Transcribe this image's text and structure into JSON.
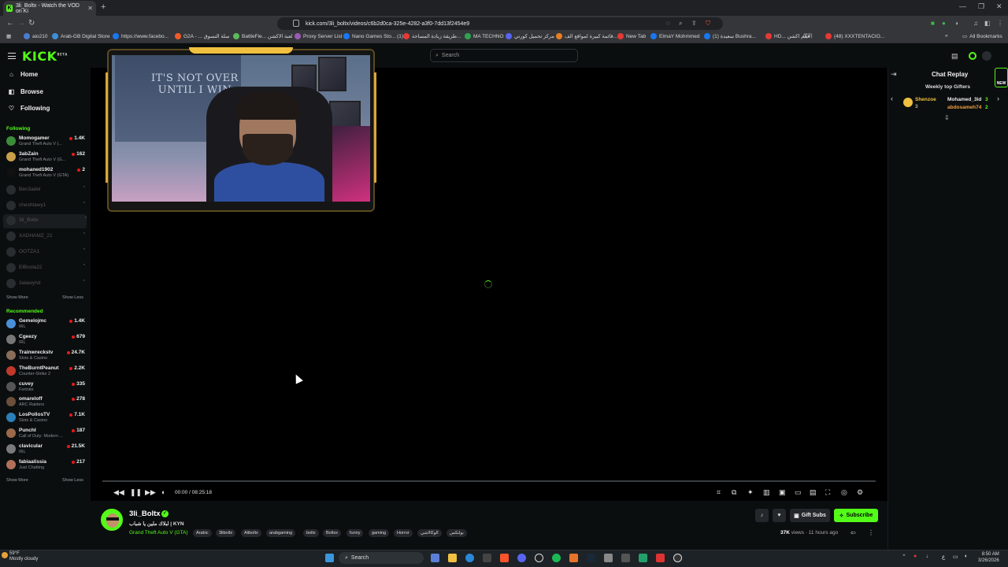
{
  "browser": {
    "tab_title": "3li_Boltx - Watch the VOD on Ki",
    "url": "kick.com/3li_boltx/videos/c6b2d0ca-325e-4282-a3f0-7dd13f2454e9",
    "bookmarks": [
      "aio210",
      "Arab-GB Digital Store",
      "https://www.facebo...",
      "G2A - ... سلة التسوق",
      "BattleFie... لعبة الاكشن",
      "Proxy Server List",
      "Nano Games Sto... (1)",
      "طريقة زيادة المساحة...",
      "MA TECHNO",
      "مركز تحميل كورتي",
      "قائمة كبيرة لمواقع الف...",
      "New Tab",
      "ElmaY Mohmmed",
      "(1) سعيدة Bushra...",
      "HD... فيلم اكشن",
      "(22)",
      "(48) XXXTENTACIO...",
      "All Bookmarks"
    ]
  },
  "kick": {
    "logo": "KICK",
    "logo_badge": "BETA",
    "search_placeholder": "Search"
  },
  "sidebar": {
    "nav": [
      {
        "label": "Home",
        "icon": "home-icon"
      },
      {
        "label": "Browse",
        "icon": "browse-icon"
      },
      {
        "label": "Following",
        "icon": "heart-icon"
      }
    ],
    "following_title": "Following",
    "following": [
      {
        "name": "Momogamer",
        "game": "Grand Theft Auto V (...",
        "viewers": "1.4K",
        "color": "#3c8d3a"
      },
      {
        "name": "3abZain",
        "game": "Grand Theft Auto V (G...",
        "viewers": "162",
        "color": "#c9a14a"
      },
      {
        "name": "mohaned1902",
        "game": "Grand Theft Auto V (GTA)",
        "viewers": "2",
        "color": "#111111"
      }
    ],
    "offline": [
      "Ben3adel",
      "cheshtawy1",
      "3li_Boltx",
      "XADHAMZ_21",
      "OOTZA1",
      "ElBoola22",
      "3alawyhd"
    ],
    "show_more": "Show More",
    "show_less": "Show Less",
    "recommended_title": "Recommended",
    "recommended": [
      {
        "name": "Gemelojmc",
        "game": "IRL",
        "viewers": "1.4K",
        "color": "#4a90d9"
      },
      {
        "name": "Cgeezy",
        "game": "IRL",
        "viewers": "679",
        "color": "#777777"
      },
      {
        "name": "Trainwreckstv",
        "game": "Slots & Casino",
        "viewers": "24.7K",
        "color": "#8a6d5a"
      },
      {
        "name": "TheBurntPeanut",
        "game": "Counter-Strike 2",
        "viewers": "2.2K",
        "color": "#c0392b"
      },
      {
        "name": "cuvey",
        "game": "Fortnite",
        "viewers": "335",
        "color": "#555555"
      },
      {
        "name": "omareloff",
        "game": "ARC Raiders",
        "viewers": "278",
        "color": "#6b4f3a"
      },
      {
        "name": "LosPollosTV",
        "game": "Slots & Casino",
        "viewers": "7.1K",
        "color": "#2a7fb8"
      },
      {
        "name": "PunchI",
        "game": "Call of Duty: Modern ...",
        "viewers": "187",
        "color": "#9a6a4a"
      },
      {
        "name": "clavicular",
        "game": "IRL",
        "viewers": "21.5K",
        "color": "#7a7a7a"
      },
      {
        "name": "fabiaalissia",
        "game": "Just Chatting",
        "viewers": "217",
        "color": "#b0705a"
      }
    ]
  },
  "video": {
    "slogan_line1": "IT'S NOT OVER",
    "slogan_line2": "UNTIL I WIN",
    "time": "00:00 / 08:25:18"
  },
  "chat": {
    "title": "Chat Replay",
    "gifters_title": "Weekly top Gifters",
    "new_badge": "NEW",
    "gifters": [
      {
        "name": "Shenzoe",
        "count": "3"
      },
      {
        "name": "Mohamed_3id",
        "count": "3"
      },
      {
        "name": "abdosameh74",
        "count": "2"
      }
    ]
  },
  "channel": {
    "username": "3li_Boltx",
    "stream_title": "لبلاك ملين يا شباب | KYN",
    "category": "Grand Theft Auto V (GTA)",
    "tags": [
      "Arabic",
      "3liboltx",
      "Aliboltx",
      "arabgaming",
      "boltx",
      "Boltxx",
      "funny",
      "gaming",
      "Horror",
      "الوكالاشي",
      "بولتكس"
    ],
    "views_count": "37K",
    "views_label": "views",
    "ago": "11 hours ago",
    "gift_subs": "Gift Subs",
    "subscribe": "Subscribe"
  },
  "taskbar": {
    "weather_temp": "59°F",
    "weather_desc": "Mostly cloudy",
    "search": "Search",
    "time": "8:50 AM",
    "date": "3/26/2026"
  },
  "colors": {
    "kick_green": "#53fc18",
    "bg": "#0b0e0f",
    "live_red": "#e91916"
  }
}
